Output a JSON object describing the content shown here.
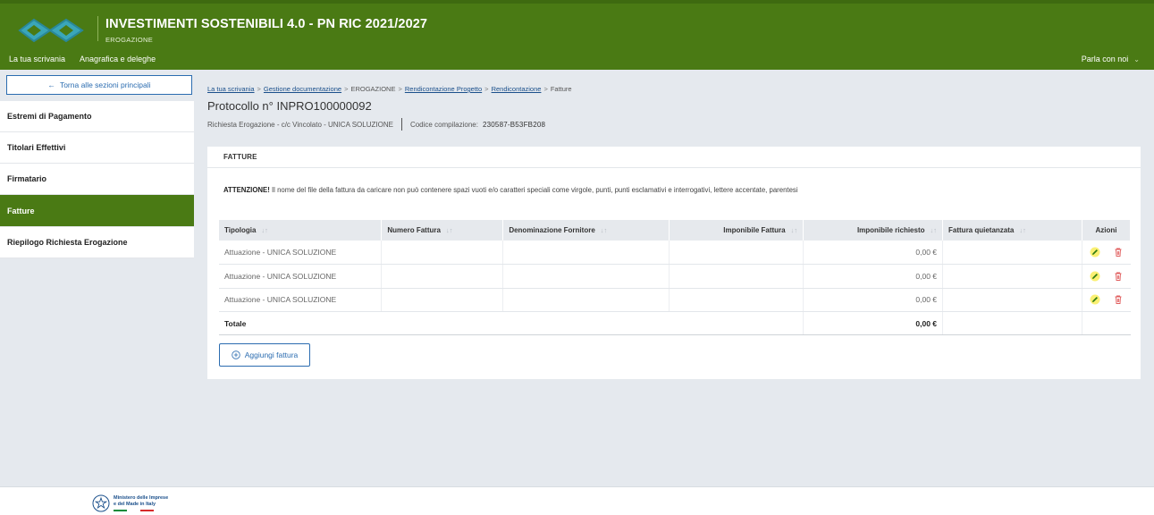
{
  "header": {
    "title": "INVESTIMENTI SOSTENIBILI 4.0 - PN RIC 2021/2027",
    "subtitle": "EROGAZIONE",
    "nav": [
      "La tua scrivania",
      "Anagrafica e deleghe"
    ],
    "contact": "Parla con noi",
    "logo_icon": "infinity-logo-icon",
    "brand_color": "#4a7a14"
  },
  "sidebar": {
    "back_label": "Torna alle sezioni principali",
    "items": [
      {
        "label": "Estremi di Pagamento",
        "active": false
      },
      {
        "label": "Titolari Effettivi",
        "active": false
      },
      {
        "label": "Firmatario",
        "active": false
      },
      {
        "label": "Fatture",
        "active": true
      },
      {
        "label": "Riepilogo Richiesta Erogazione",
        "active": false
      }
    ]
  },
  "breadcrumb": {
    "items": [
      "La tua scrivania",
      "Gestione documentazione",
      "EROGAZIONE",
      "Rendicontazione Progetto",
      "Rendicontazione",
      "Fatture"
    ],
    "separator": ">"
  },
  "protocol": {
    "title": "Protocollo n° INPRO100000092",
    "request": "Richiesta Erogazione - c/c Vincolato - UNICA SOLUZIONE",
    "code_label": "Codice compilazione:",
    "code_value": "230587-B53FB208"
  },
  "card": {
    "heading": "FATTURE",
    "warning_strong": "ATTENZIONE!",
    "warning_text": " Il nome del file della fattura da caricare non può contenere spazi vuoti e/o caratteri speciali come virgole, punti, punti esclamativi e interrogativi, lettere accentate, parentesi"
  },
  "table": {
    "columns": [
      {
        "label": "Tipologia",
        "sortable": true
      },
      {
        "label": "Numero Fattura",
        "sortable": true
      },
      {
        "label": "Denominazione Fornitore",
        "sortable": true
      },
      {
        "label": "Imponibile Fattura",
        "sortable": true
      },
      {
        "label": "Imponibile richiesto",
        "sortable": true
      },
      {
        "label": "Fattura quietanzata",
        "sortable": true
      },
      {
        "label": "Azioni",
        "sortable": false
      }
    ],
    "sort_glyph": "↓↑",
    "rows": [
      {
        "tipologia": "Attuazione - UNICA SOLUZIONE",
        "numero": "",
        "fornitore": "",
        "imponibile_fattura": "",
        "imponibile_richiesto": "0,00 €",
        "quietanzata": ""
      },
      {
        "tipologia": "Attuazione - UNICA SOLUZIONE",
        "numero": "",
        "fornitore": "",
        "imponibile_fattura": "",
        "imponibile_richiesto": "0,00 €",
        "quietanzata": ""
      },
      {
        "tipologia": "Attuazione - UNICA SOLUZIONE",
        "numero": "",
        "fornitore": "",
        "imponibile_fattura": "",
        "imponibile_richiesto": "0,00 €",
        "quietanzata": ""
      }
    ],
    "total_label": "Totale",
    "total_value": "0,00 €",
    "edit_icon": "pencil-edit-icon",
    "delete_icon": "trash-delete-icon",
    "delete_color": "#e05c5c",
    "edit_highlight": "#f5e400"
  },
  "add_button": "Aggiungi fattura",
  "footer": {
    "ministry_line1": "Ministero delle Imprese",
    "ministry_line2": "e del Made in Italy",
    "emblem_icon": "italian-republic-emblem-icon"
  }
}
